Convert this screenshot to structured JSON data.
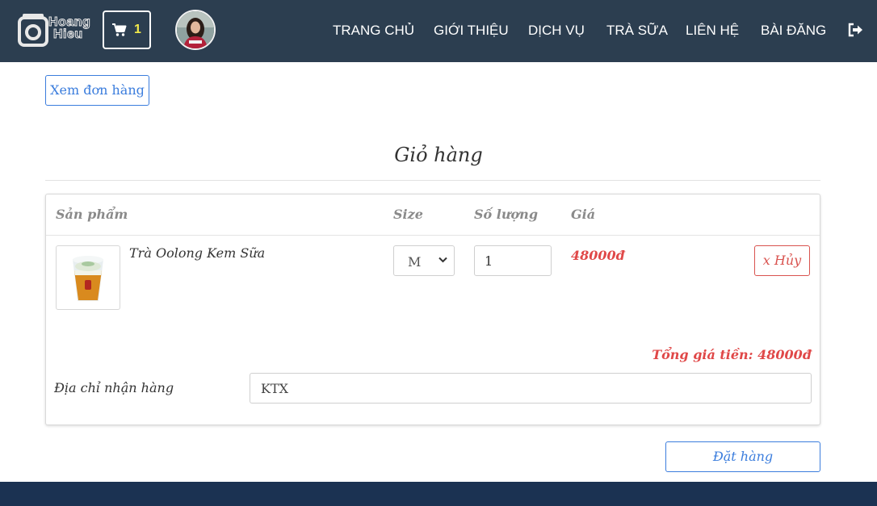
{
  "header": {
    "logo_text_line1": "Hoang",
    "logo_text_line2": "Hieu",
    "cart_count": "1",
    "nav": [
      {
        "label": "TRANG CHỦ"
      },
      {
        "label": "GIỚI THIỆU"
      },
      {
        "label": "DỊCH VỤ"
      },
      {
        "label": "TRÀ SỮA"
      },
      {
        "label": "LIÊN HỆ"
      },
      {
        "label": "BÀI ĐĂNG"
      }
    ],
    "icons": {
      "cart": "cart-icon",
      "logout": "logout-icon",
      "avatar": "user-avatar"
    }
  },
  "actions": {
    "view_orders_label": "Xem đơn hàng",
    "place_order_label": "Đặt hàng"
  },
  "cart": {
    "title": "Giỏ hàng",
    "columns": {
      "product": "Sản phẩm",
      "size": "Size",
      "quantity": "Số lượng",
      "price": "Giá"
    },
    "items": [
      {
        "name": "Trà Oolong Kem Sữa",
        "size": "M",
        "quantity": "1",
        "price": "48000đ",
        "remove_label": "x Hủy"
      }
    ],
    "total_text": "Tổng giá tiền: 48000đ",
    "address_label": "Địa chỉ nhận hàng",
    "address_value": "KTX"
  },
  "colors": {
    "header_bg": "#2c3e50",
    "footer_bg": "#1b3252",
    "accent_blue": "#3b7ddd",
    "danger_red": "#e04848",
    "cart_count": "#f1e94a"
  }
}
